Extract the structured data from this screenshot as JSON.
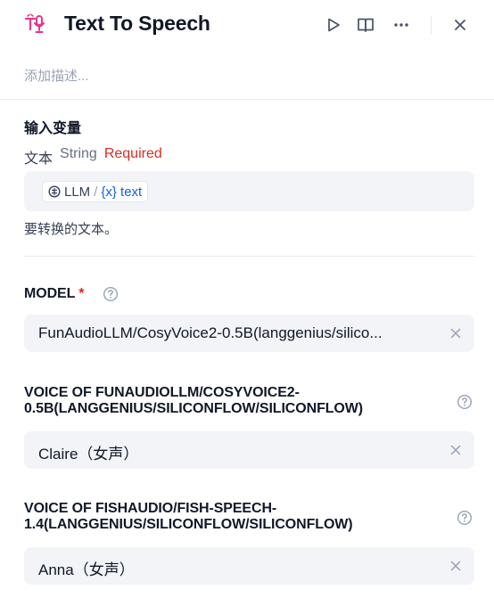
{
  "header": {
    "app_icon": "text-to-speech-icon",
    "title": "Text To Speech",
    "actions": [
      "run-icon",
      "book-icon",
      "more-icon",
      "close-icon"
    ]
  },
  "description_placeholder": "添加描述...",
  "input_variables": {
    "section_title": "输入变量",
    "variable": {
      "name": "文本",
      "type": "String",
      "required_label": "Required",
      "source_node": "LLM",
      "separator": "/",
      "source_var": "{x} text",
      "hint": "要转换的文本。"
    }
  },
  "model": {
    "label": "MODEL",
    "required_mark": "*",
    "value": "FunAudioLLM/CosyVoice2-0.5B(langgenius/silico..."
  },
  "voice1": {
    "label_line1": "VOICE OF FUNAUDIOLLM/COSYVOICE2-",
    "label_line2": "0.5B(LANGGENIUS/SILICONFLOW/SILICONFLOW)",
    "value": "Claire（女声）"
  },
  "voice2": {
    "label_line1": "VOICE OF FISHAUDIO/FISH-SPEECH-",
    "label_line2": "1.4(LANGGENIUS/SILICONFLOW/SILICONFLOW)",
    "value": "Anna（女声）"
  },
  "colors": {
    "accent_pink": "#e4388e",
    "required_red": "#d92d20",
    "variable_blue": "#155eef",
    "field_bg": "#f2f4f7"
  }
}
